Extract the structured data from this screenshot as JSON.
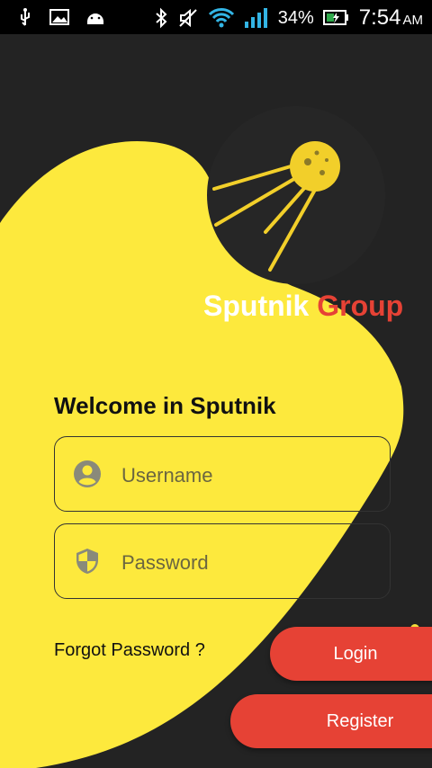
{
  "status_bar": {
    "battery_percent": "34%",
    "time": "7:54",
    "ampm": "AM",
    "icons": [
      "usb-icon",
      "image-icon",
      "android-icon",
      "bluetooth-icon",
      "mute-icon",
      "wifi-icon",
      "signal-icon",
      "battery-charging-icon"
    ]
  },
  "brand": {
    "name_part1": "Sputnik",
    "name_part2": "Group",
    "logo": "sputnik-satellite-logo"
  },
  "welcome": "Welcome in Sputnik",
  "form": {
    "username_placeholder": "Username",
    "password_placeholder": "Password"
  },
  "forgot_password": "Forgot Password ?",
  "buttons": {
    "login": "Login",
    "register": "Register"
  },
  "colors": {
    "background": "#232323",
    "accent_yellow": "#fde93d",
    "accent_red": "#e64235"
  }
}
